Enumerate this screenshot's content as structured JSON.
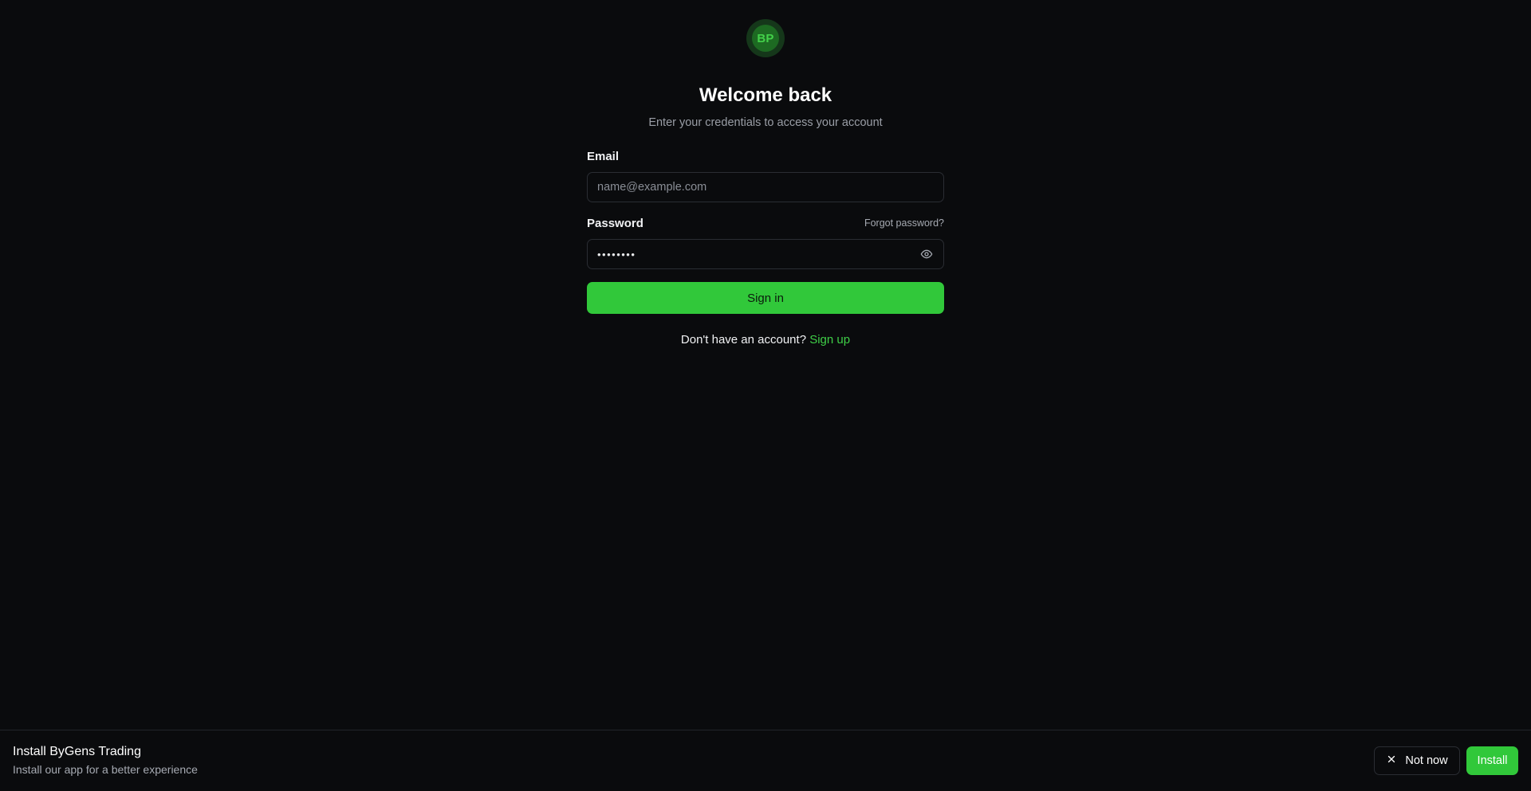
{
  "brand": {
    "logo_text": "BP",
    "accent": "#31c83a"
  },
  "auth": {
    "title": "Welcome back",
    "subtitle": "Enter your credentials to access your account",
    "email": {
      "label": "Email",
      "placeholder": "name@example.com",
      "value": ""
    },
    "password": {
      "label": "Password",
      "forgot_label": "Forgot password?",
      "masked_value": "••••••••",
      "toggle_icon": "eye-icon"
    },
    "signin_label": "Sign in",
    "signup_prompt": "Don't have an account?",
    "signup_link": "Sign up"
  },
  "install_banner": {
    "title": "Install ByGens Trading",
    "description": "Install our app for a better experience",
    "dismiss_label": "Not now",
    "dismiss_icon": "close-icon",
    "install_label": "Install"
  }
}
